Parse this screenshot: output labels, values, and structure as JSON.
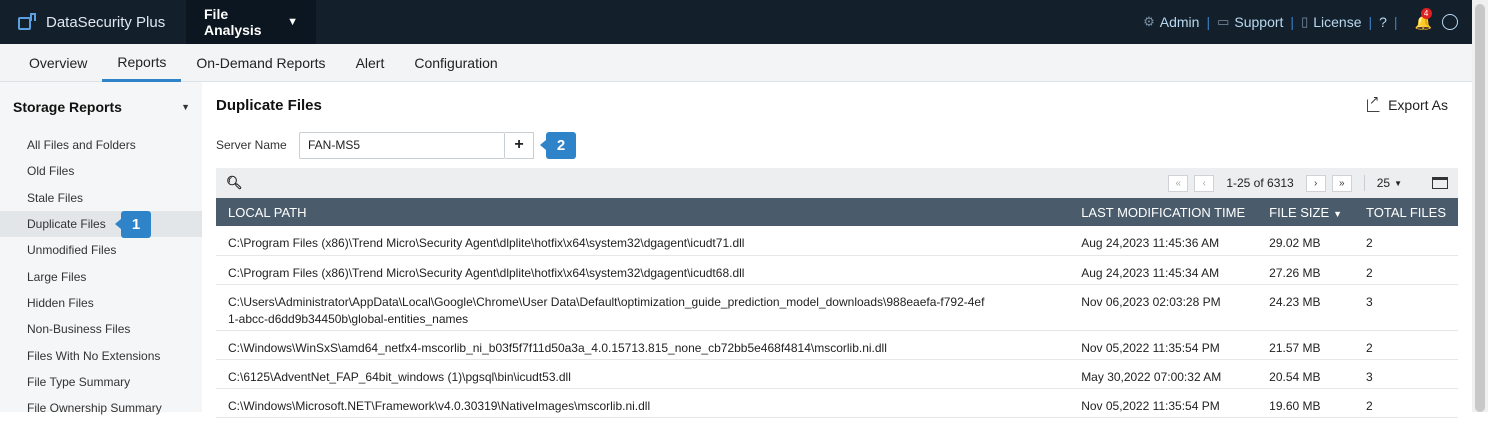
{
  "app": {
    "brand": "DataSecurity Plus",
    "module": "File Analysis"
  },
  "top_links": {
    "admin": "Admin",
    "support": "Support",
    "license": "License",
    "help": "?",
    "notification_count": "4"
  },
  "tabs": [
    "Overview",
    "Reports",
    "On-Demand Reports",
    "Alert",
    "Configuration"
  ],
  "active_tab": "Reports",
  "sidebar": {
    "section": "Storage Reports",
    "items": [
      "All Files and Folders",
      "Old Files",
      "Stale Files",
      "Duplicate Files",
      "Unmodified Files",
      "Large Files",
      "Hidden Files",
      "Non-Business Files",
      "Files With No Extensions",
      "File Type Summary",
      "File Ownership Summary"
    ],
    "active": "Duplicate Files"
  },
  "markers": {
    "m1": "1",
    "m2": "2"
  },
  "main": {
    "title": "Duplicate Files",
    "export_label": "Export As",
    "server_label": "Server Name",
    "server_value": "FAN-MS5",
    "add_button": "+"
  },
  "pager": {
    "range": "1-25 of 6313",
    "page_size": "25"
  },
  "table": {
    "headers": {
      "path": "LOCAL PATH",
      "modified": "LAST MODIFICATION TIME",
      "size": "FILE SIZE",
      "total": "TOTAL FILES"
    },
    "rows": [
      {
        "path": "C:\\Program Files (x86)\\Trend Micro\\Security Agent\\dlplite\\hotfix\\x64\\system32\\dgagent\\icudt71.dll",
        "modified": "Aug 24,2023 11:45:36 AM",
        "size": "29.02 MB",
        "total": "2"
      },
      {
        "path": "C:\\Program Files (x86)\\Trend Micro\\Security Agent\\dlplite\\hotfix\\x64\\system32\\dgagent\\icudt68.dll",
        "modified": "Aug 24,2023 11:45:34 AM",
        "size": "27.26 MB",
        "total": "2"
      },
      {
        "path": "C:\\Users\\Administrator\\AppData\\Local\\Google\\Chrome\\User Data\\Default\\optimization_guide_prediction_model_downloads\\988eaefa-f792-4ef1-abcc-d6dd9b34450b\\global-entities_names",
        "modified": "Nov 06,2023 02:03:28 PM",
        "size": "24.23 MB",
        "total": "3"
      },
      {
        "path": "C:\\Windows\\WinSxS\\amd64_netfx4-mscorlib_ni_b03f5f7f11d50a3a_4.0.15713.815_none_cb72bb5e468f4814\\mscorlib.ni.dll",
        "modified": "Nov 05,2022 11:35:54 PM",
        "size": "21.57 MB",
        "total": "2"
      },
      {
        "path": "C:\\6125\\AdventNet_FAP_64bit_windows (1)\\pgsql\\bin\\icudt53.dll",
        "modified": "May 30,2022 07:00:32 AM",
        "size": "20.54 MB",
        "total": "3"
      },
      {
        "path": "C:\\Windows\\Microsoft.NET\\Framework\\v4.0.30319\\NativeImages\\mscorlib.ni.dll",
        "modified": "Nov 05,2022 11:35:54 PM",
        "size": "19.60 MB",
        "total": "2"
      }
    ]
  },
  "colors": {
    "topbar": "#13202c",
    "accent": "#2f83c8",
    "table_header": "#4a5c6c"
  }
}
